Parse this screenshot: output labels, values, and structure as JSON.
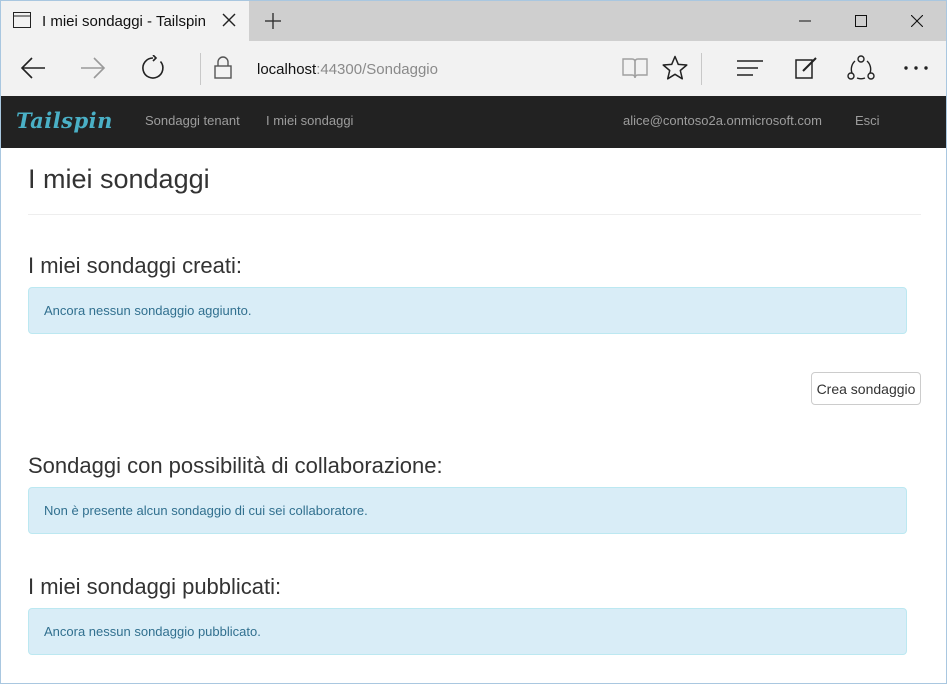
{
  "browser": {
    "tab_title": "I miei sondaggi - Tailspin",
    "url_host": "localhost",
    "url_rest": ":44300/Sondaggio"
  },
  "navbar": {
    "brand": "Tailspin",
    "links": [
      "Sondaggi tenant",
      "I miei sondaggi"
    ],
    "user": "alice@contoso2a.onmicrosoft.com",
    "logout": "Esci",
    "brand_color": "#4ab0c6",
    "background_color": "#222222"
  },
  "main": {
    "title": "I miei sondaggi",
    "created": {
      "heading": "I miei sondaggi creati:",
      "empty_message": "Ancora nessun sondaggio aggiunto."
    },
    "create_button": "Crea sondaggio",
    "collaboration": {
      "heading": "Sondaggi con possibilità di collaborazione:",
      "empty_message": "Non è presente alcun sondaggio di cui sei collaboratore."
    },
    "published": {
      "heading": "I miei sondaggi pubblicati:",
      "empty_message": "Ancora nessun sondaggio pubblicato."
    },
    "alert_color": "#d9edf7"
  }
}
